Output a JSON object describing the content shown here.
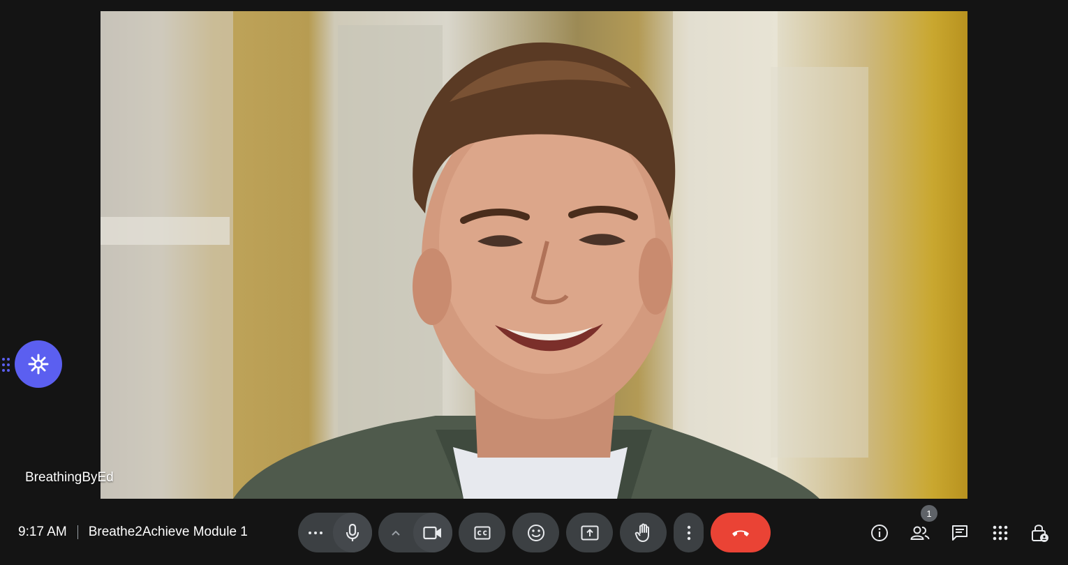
{
  "participant": {
    "name": "BreathingByEd"
  },
  "meeting": {
    "time": "9:17 AM",
    "title": "Breathe2Achieve Module 1"
  },
  "controls": [
    {
      "name": "more-reactions",
      "icon": "ellipsis-icon"
    },
    {
      "name": "microphone",
      "icon": "microphone-icon"
    },
    {
      "name": "camera-options",
      "icon": "chevron-up-icon"
    },
    {
      "name": "camera",
      "icon": "video-camera-icon"
    },
    {
      "name": "captions",
      "icon": "closed-captions-icon"
    },
    {
      "name": "emoji-reactions",
      "icon": "smiley-icon"
    },
    {
      "name": "present",
      "icon": "present-screen-icon"
    },
    {
      "name": "raise-hand",
      "icon": "hand-icon"
    },
    {
      "name": "more-options",
      "icon": "vertical-dots-icon"
    },
    {
      "name": "leave-call",
      "icon": "hang-up-icon"
    }
  ],
  "right_controls": [
    {
      "name": "meeting-details",
      "icon": "info-icon"
    },
    {
      "name": "people",
      "icon": "people-icon"
    },
    {
      "name": "chat",
      "icon": "chat-icon"
    },
    {
      "name": "activities",
      "icon": "apps-grid-icon"
    },
    {
      "name": "host-controls",
      "icon": "lock-person-icon"
    }
  ],
  "people_count": "1",
  "colors": {
    "background": "#141414",
    "pill": "#3c4043",
    "end_call": "#ea4335",
    "assistant": "#5b5ff0"
  }
}
